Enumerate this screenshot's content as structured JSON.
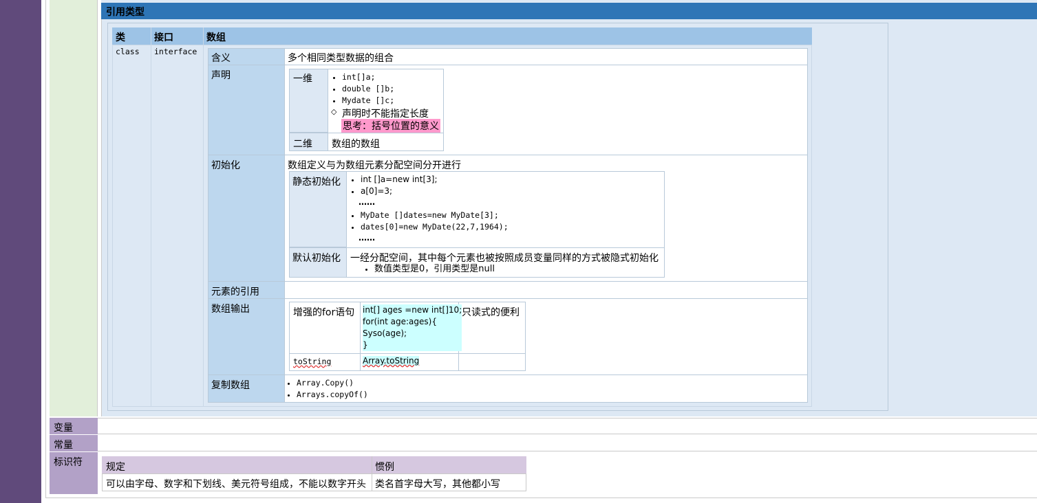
{
  "section_title": "引用类型",
  "type_table": {
    "headers": [
      "类",
      "接口",
      "数组"
    ],
    "class_value": "class",
    "interface_value": "interface"
  },
  "array": {
    "meaning": {
      "label": "含义",
      "value": "多个相同类型数据的组合"
    },
    "declaration": {
      "label": "声明",
      "one_dim_label": "一维",
      "one_dim_items": [
        "int[]a;",
        "double []b;",
        "Mydate []c;"
      ],
      "note": "声明时不能指定长度",
      "think": "思考：括号位置的意义",
      "two_dim_label": "二维",
      "two_dim_value": "数组的数组"
    },
    "init": {
      "label": "初始化",
      "desc": "数组定义与为数组元素分配空间分开进行",
      "static_label": "静态初始化",
      "static_code1": [
        "int []a=new int[3];",
        "a[0]=3;"
      ],
      "ellipsis": "……",
      "static_code2": [
        "MyDate []dates=new MyDate[3];",
        "dates[0]=new MyDate(22,7,1964);"
      ],
      "default_label": "默认初始化",
      "default_desc": "一经分配空间，其中每个元素也被按照成员变量同样的方式被隐式初始化",
      "default_bullet": "数值类型是0，引用类型是null"
    },
    "element_ref": {
      "label": "元素的引用"
    },
    "output": {
      "label": "数组输出",
      "enhanced_label": "增强的for语句",
      "enhanced_code": [
        "int[] ages =new int[]10;",
        "for(int age:ages){",
        "Syso(age);",
        "}"
      ],
      "enhanced_note": "只读式的便利",
      "tostring_label": "toString",
      "tostring_value": "Array.toString"
    },
    "copy": {
      "label": "复制数组",
      "items": [
        "Array.Copy()",
        "Arrays.copyOf()"
      ]
    }
  },
  "rows": {
    "variable": "变量",
    "constant": "常量",
    "identifier": "标识符"
  },
  "identifier_table": {
    "headers": [
      "规定",
      "惯例"
    ],
    "rule": "可以由字母、数字和下划线、美元符号组成，不能以数字开头",
    "convention": "类名首字母大写，其他都小写"
  },
  "colors": {
    "left_bar": "#604a7b",
    "left_green": "#e2efda",
    "header_blue": "#2e75b6",
    "panel_blue": "#dde8f4",
    "label_blue": "#bdd7ee",
    "header_light_blue": "#9dc3e6",
    "purple_label": "#b2a1c7",
    "lilac_header": "#d6c8e0",
    "cyan_highlight": "#ccffff",
    "pink_highlight": "#ff99cc"
  }
}
